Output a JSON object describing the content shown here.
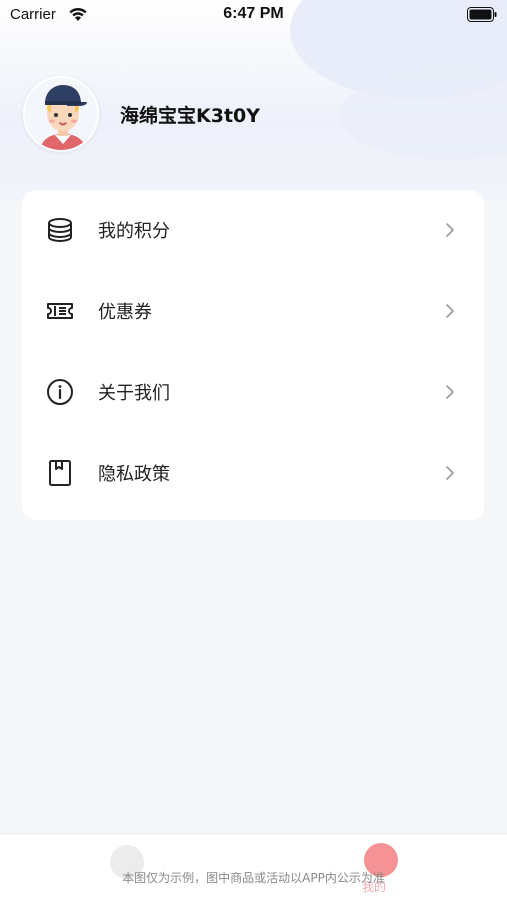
{
  "status_bar": {
    "carrier": "Carrier",
    "time": "6:47 PM"
  },
  "profile": {
    "username": "海绵宝宝K3t0Y"
  },
  "menu": {
    "items": [
      {
        "label": "我的积分",
        "icon": "coins-stack-icon"
      },
      {
        "label": "优惠券",
        "icon": "ticket-icon"
      },
      {
        "label": "关于我们",
        "icon": "info-circle-icon"
      },
      {
        "label": "隐私政策",
        "icon": "document-icon"
      }
    ]
  },
  "tab_bar": {
    "mine_label": "我的",
    "disclaimer": "本图仅为示例，图中商品或活动以APP内公示为准"
  },
  "colors": {
    "accent": "#f26d73",
    "text": "#222222",
    "chevron": "#9a9a9a"
  }
}
